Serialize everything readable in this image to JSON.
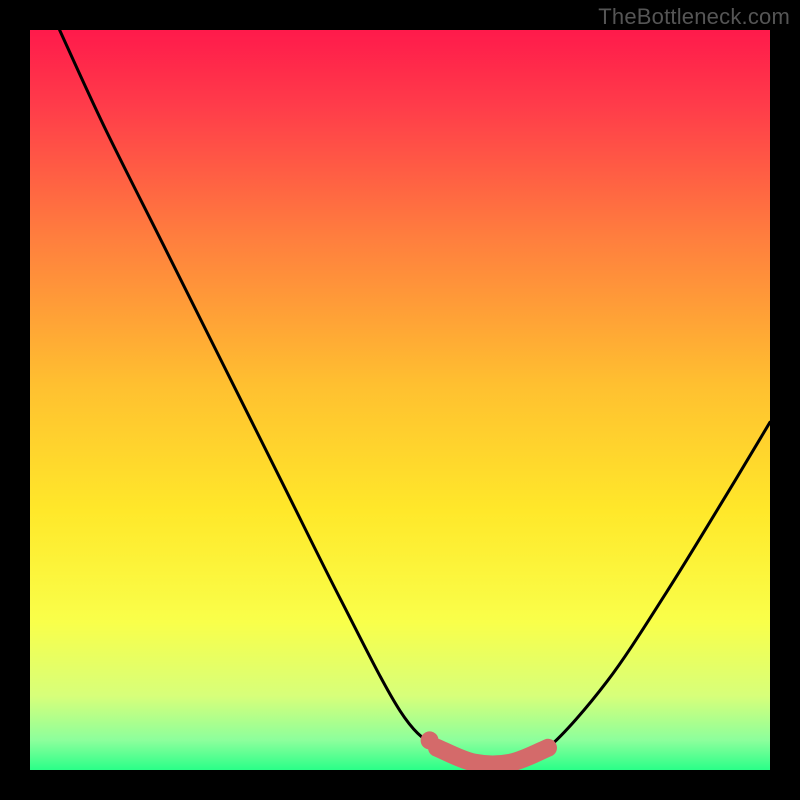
{
  "watermark": "TheBottleneck.com",
  "chart_data": {
    "type": "line",
    "title": "",
    "xlabel": "",
    "ylabel": "",
    "xlim": [
      0,
      100
    ],
    "ylim": [
      0,
      100
    ],
    "curve": {
      "name": "bottleneck-curve",
      "x": [
        4,
        10,
        18,
        26,
        34,
        42,
        50,
        55,
        60,
        65,
        70,
        78,
        86,
        94,
        100
      ],
      "y": [
        100,
        87,
        71,
        55,
        39,
        23,
        8,
        3,
        1,
        1,
        3,
        12,
        24,
        37,
        47
      ]
    },
    "highlight_segment": {
      "name": "optimal-range",
      "color": "#d46a6a",
      "x": [
        55,
        60,
        65,
        70
      ],
      "y": [
        3,
        1,
        1,
        3
      ]
    },
    "highlight_dot": {
      "name": "marker",
      "color": "#d46a6a",
      "x": 54,
      "y": 4
    },
    "gradient_stops": [
      {
        "offset": 0.0,
        "color": "#ff1a4b"
      },
      {
        "offset": 0.1,
        "color": "#ff3b4a"
      },
      {
        "offset": 0.28,
        "color": "#ff7e3e"
      },
      {
        "offset": 0.48,
        "color": "#ffc030"
      },
      {
        "offset": 0.65,
        "color": "#ffe82a"
      },
      {
        "offset": 0.8,
        "color": "#f9ff4a"
      },
      {
        "offset": 0.9,
        "color": "#d7ff7a"
      },
      {
        "offset": 0.96,
        "color": "#8cff9c"
      },
      {
        "offset": 1.0,
        "color": "#2aff88"
      }
    ]
  }
}
